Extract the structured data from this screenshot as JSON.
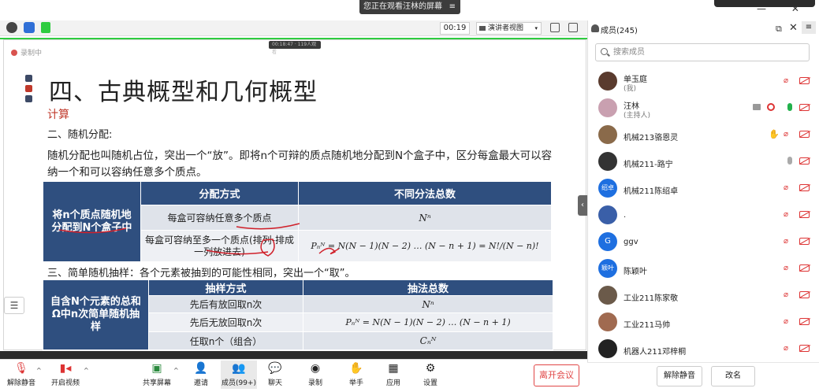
{
  "banner": {
    "text": "您正在观看汪林的屏幕",
    "menu_icon": "menu-icon"
  },
  "toolbar": {
    "time": "00:19",
    "view_label": "演讲者视图",
    "caret": "▾"
  },
  "mini_status": "00:18:47 · 119人观看",
  "recording": "录制中",
  "slide": {
    "title": "四、古典概型和几何概型",
    "subtitle": "计算",
    "section2": "二、随机分配:",
    "paragraph": "随机分配也叫随机占位，突出一个“放”。即将n个可辩的质点随机地分配到N个盒子中，区分每盒最大可以容纳一个和可以容纳任意多个质点。",
    "table1": {
      "left": "将n个质点随机地分配到N个盒子中",
      "headers": [
        "分配方式",
        "不同分法总数"
      ],
      "rows": [
        [
          "每盒可容纳任意多个质点",
          "Nⁿ"
        ],
        [
          "每盒可容纳至多一个质点(排列-排成一列放进去)",
          "Pₙᴺ = N(N − 1)(N − 2) … (N − n + 1) = N!/(N − n)!"
        ]
      ]
    },
    "section3": "三、简单随机抽样：各个元素被抽到的可能性相同，突出一个“取”。",
    "table2": {
      "left": "自含N个元素的总和Ω中n次简单随机抽样",
      "headers": [
        "抽样方式",
        "抽法总数"
      ],
      "rows": [
        [
          "先后有放回取n次",
          "Nⁿ"
        ],
        [
          "先后无放回取n次",
          "Pₙᴺ = N(N − 1)(N − 2) … (N − n + 1)"
        ],
        [
          "任取n个（组合）",
          "Cₙᴺ"
        ]
      ]
    }
  },
  "controls": [
    {
      "label": "解除静音",
      "icon": "microphone-muted-icon"
    },
    {
      "label": "开启视频",
      "icon": "camera-off-icon"
    },
    {
      "label": "共享屏幕",
      "icon": "share-screen-icon"
    },
    {
      "label": "邀请",
      "icon": "invite-icon"
    },
    {
      "label": "成员(99+)",
      "icon": "members-icon"
    },
    {
      "label": "聊天",
      "icon": "chat-icon"
    },
    {
      "label": "录制",
      "icon": "record-icon"
    },
    {
      "label": "举手",
      "icon": "raise-hand-icon"
    },
    {
      "label": "应用",
      "icon": "apps-icon"
    },
    {
      "label": "设置",
      "icon": "settings-icon"
    }
  ],
  "leave": "离开会议",
  "panel": {
    "title": "成员(245)",
    "search_placeholder": "搜索成员",
    "members": [
      {
        "name": "单玉庭",
        "role": "(我)",
        "avatar_color": "#5a3b2e",
        "avatar_text": ""
      },
      {
        "name": "汪林",
        "role": "(主持人)",
        "avatar_color": "#c9a0b0",
        "avatar_text": ""
      },
      {
        "name": "机械213骆恩灵",
        "role": "",
        "avatar_color": "#8a6a4a",
        "avatar_text": ""
      },
      {
        "name": "机械211-路宁",
        "role": "",
        "avatar_color": "#333333",
        "avatar_text": ""
      },
      {
        "name": "机械211陈绍卓",
        "role": "",
        "avatar_color": "#1e6fe0",
        "avatar_text": "绍卓"
      },
      {
        "name": ".",
        "role": "",
        "avatar_color": "#3a5fa8",
        "avatar_text": ""
      },
      {
        "name": "ggv",
        "role": "",
        "avatar_color": "#1e6fe0",
        "avatar_text": "G"
      },
      {
        "name": "陈颖叶",
        "role": "",
        "avatar_color": "#1e6fe0",
        "avatar_text": "颖叶"
      },
      {
        "name": "工业211陈家敬",
        "role": "",
        "avatar_color": "#6b5a4a",
        "avatar_text": ""
      },
      {
        "name": "工业211马帅",
        "role": "",
        "avatar_color": "#a06a50",
        "avatar_text": ""
      },
      {
        "name": "机器人211邓梓桐",
        "role": "",
        "avatar_color": "#222222",
        "avatar_text": ""
      }
    ],
    "unmute_all": "解除静音",
    "rename": "改名"
  }
}
